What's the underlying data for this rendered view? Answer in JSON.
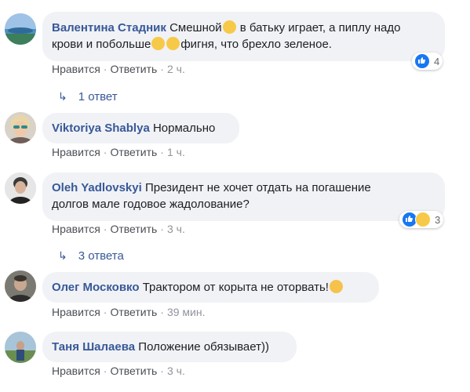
{
  "comments": [
    {
      "author": "Валентина Стадник",
      "text_parts": [
        "Смешной",
        "в батьку играет, а пиплу надо",
        "крови и побольше",
        "фигня, что брехло зеленое."
      ],
      "reactions": {
        "icons": [
          "like-icon"
        ],
        "count": "4"
      },
      "actions": {
        "like": "Нравится",
        "reply": "Ответить",
        "time": "2 ч."
      },
      "replies": "1 ответ"
    },
    {
      "author": "Viktoriya Shablya",
      "text": "Нормально",
      "actions": {
        "like": "Нравится",
        "reply": "Ответить",
        "time": "1 ч."
      }
    },
    {
      "author": "Oleh Yadlovskyi",
      "text_line1": "Президент не хочет отдать на погашение",
      "text_line2": "долгов мале годовое жадолование?",
      "reactions": {
        "icons": [
          "like-icon",
          "sad-icon"
        ],
        "count": "3"
      },
      "actions": {
        "like": "Нравится",
        "reply": "Ответить",
        "time": "3 ч."
      },
      "replies": "3 ответа"
    },
    {
      "author": "Олег Московко",
      "text": "Трактором от корыта не оторвать!",
      "actions": {
        "like": "Нравится",
        "reply": "Ответить",
        "time": "39 мин."
      }
    },
    {
      "author": "Таня Шалаева",
      "text": "Положение обязывает))",
      "actions": {
        "like": "Нравится",
        "reply": "Ответить",
        "time": "3 ч."
      }
    }
  ],
  "colors": {
    "author": "#385898",
    "bubble": "#f0f2f5",
    "like_blue": "#1877f2",
    "meta_text": "#606770"
  }
}
